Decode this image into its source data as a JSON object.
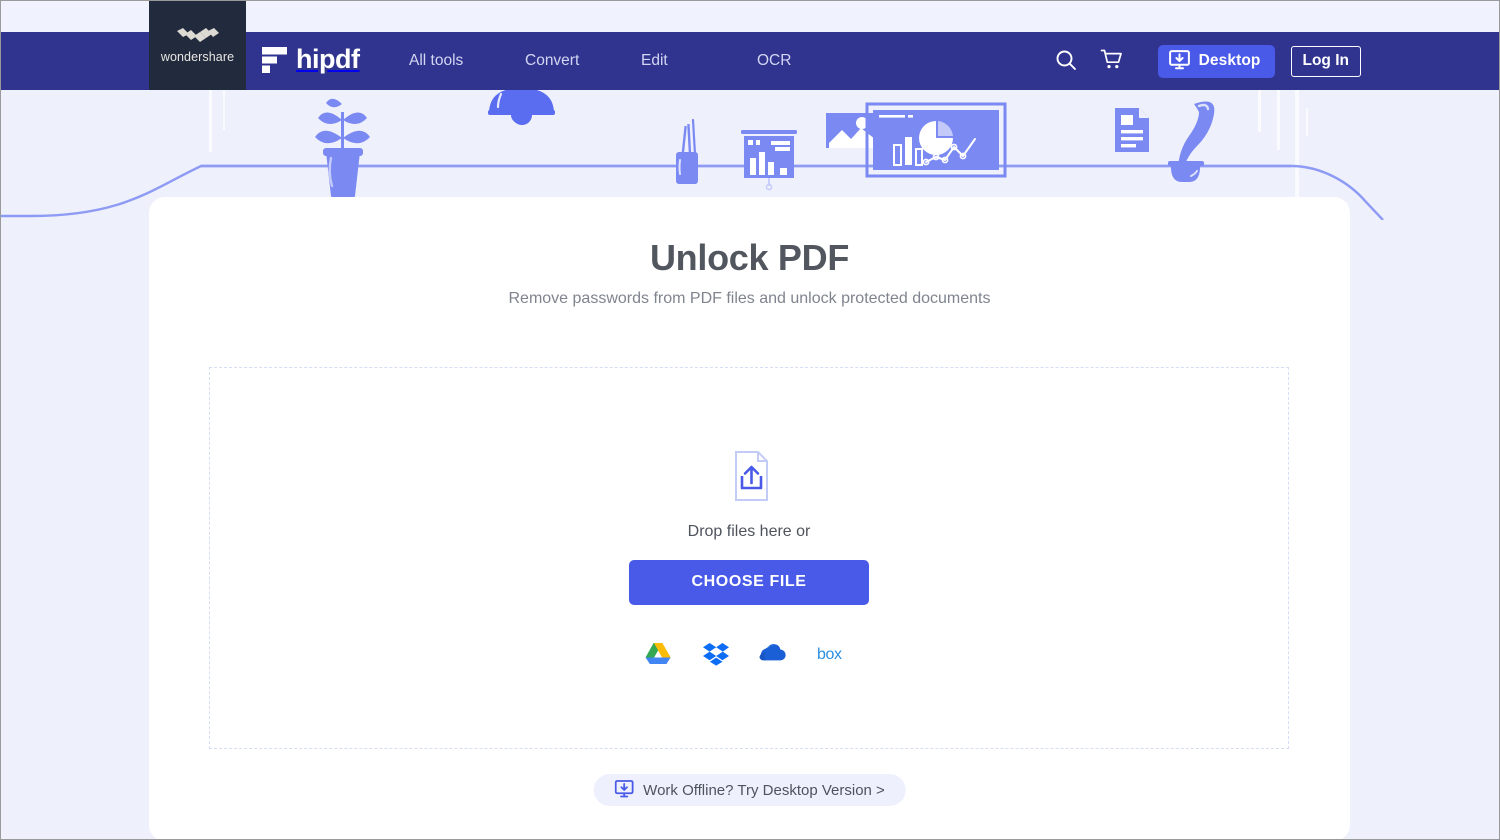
{
  "brand": {
    "wondershare": "wondershare",
    "hipdf": "hipdf"
  },
  "nav": {
    "links": [
      {
        "label": "All tools"
      },
      {
        "label": "Convert"
      },
      {
        "label": "Edit"
      },
      {
        "label": "OCR"
      }
    ],
    "search_icon": "search-icon",
    "cart_icon": "cart-icon",
    "desktop_button": "Desktop",
    "login_button": "Log In"
  },
  "page": {
    "title": "Unlock PDF",
    "subtitle": "Remove passwords from PDF files and unlock protected documents"
  },
  "dropzone": {
    "upload_icon": "file-upload-icon",
    "drop_text": "Drop files here or",
    "choose_file_button": "CHOOSE FILE",
    "cloud_sources": [
      {
        "name": "google-drive",
        "label": "Google Drive"
      },
      {
        "name": "dropbox",
        "label": "Dropbox"
      },
      {
        "name": "onedrive",
        "label": "OneDrive"
      },
      {
        "name": "box",
        "label": "Box"
      }
    ]
  },
  "offline": {
    "icon": "desktop-download-icon",
    "label": "Work Offline? Try Desktop Version >"
  },
  "colors": {
    "navbar_blue": "#30348f",
    "brand_dark": "#212b3d",
    "accent_blue": "#4a5ae8",
    "page_bg": "#eef0fc",
    "illustration_blue": "#7b89f2",
    "title_gray": "#52565e",
    "subtitle_gray": "#7f848e",
    "dash_border": "#d8ddf7"
  }
}
